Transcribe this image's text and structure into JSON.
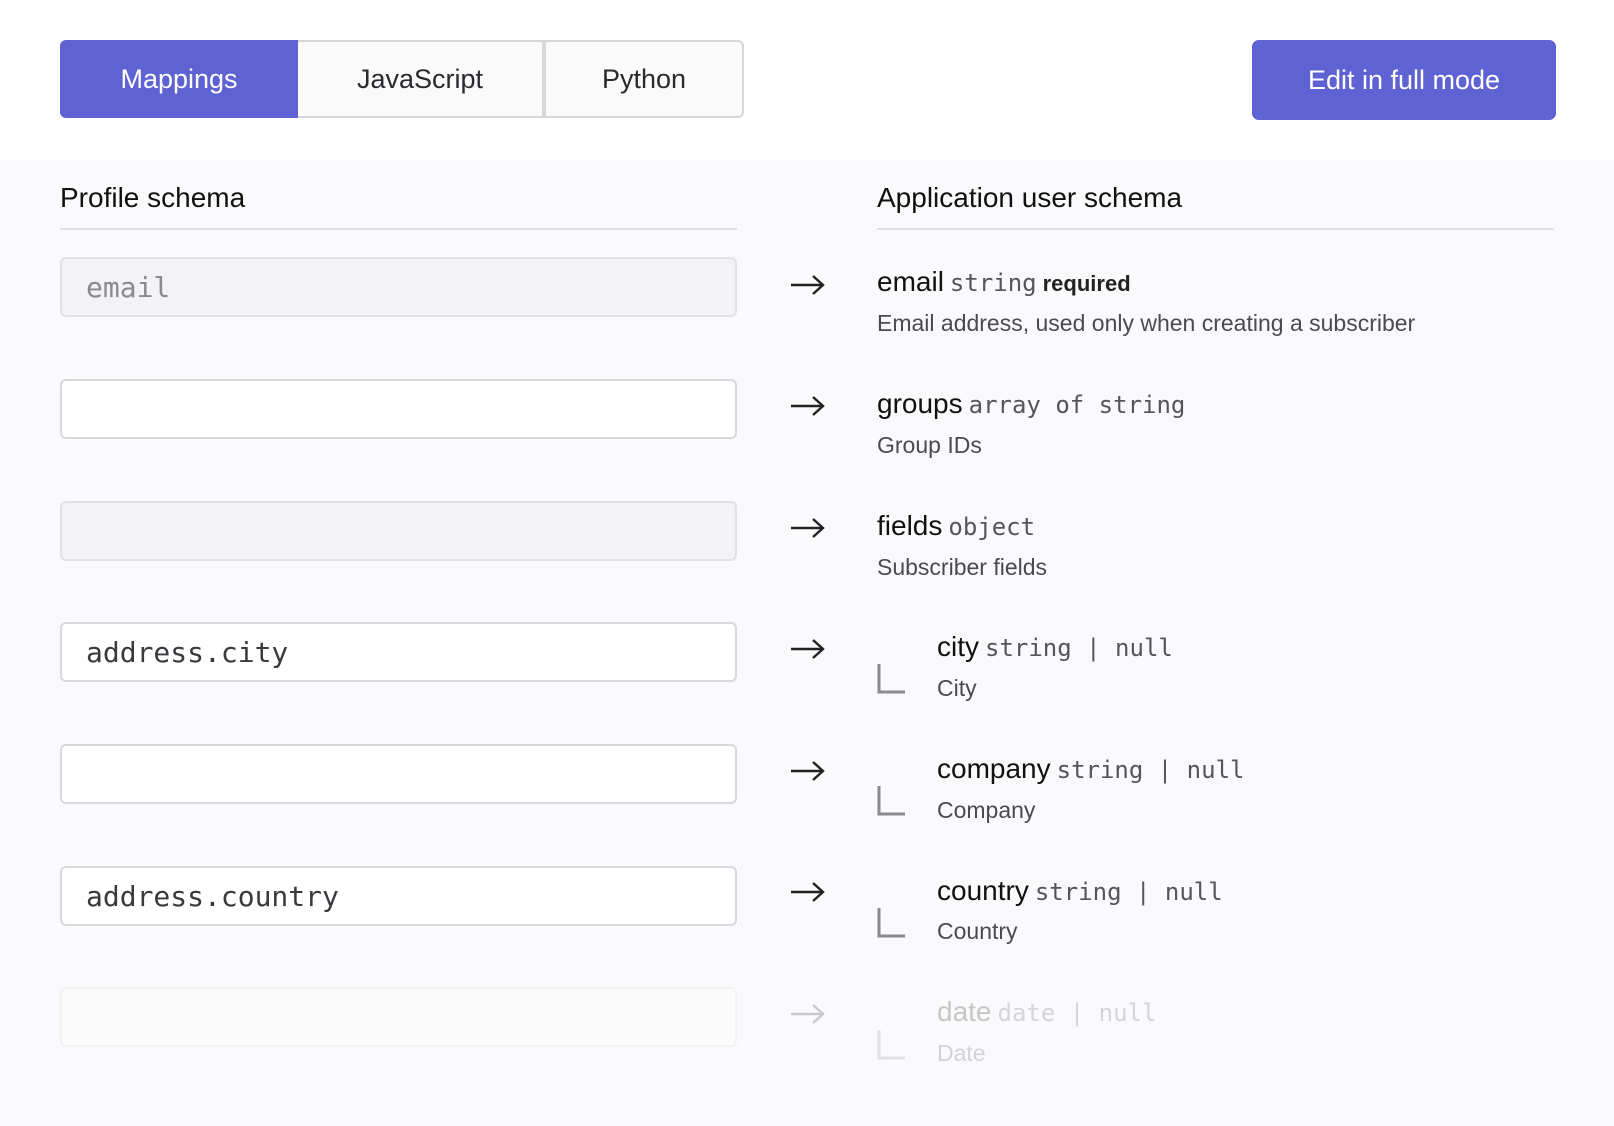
{
  "tabs": [
    {
      "label": "Mappings",
      "active": true
    },
    {
      "label": "JavaScript",
      "active": false
    },
    {
      "label": "Python",
      "active": false
    }
  ],
  "actions": {
    "edit_full_mode": "Edit in full mode"
  },
  "columns": {
    "left": "Profile schema",
    "right": "Application user schema"
  },
  "rows": [
    {
      "input_value": "",
      "input_placeholder": "email",
      "input_disabled": true,
      "name": "email",
      "type": "string",
      "required": "required",
      "description": "Email address, used only when creating a subscriber"
    },
    {
      "input_value": "",
      "input_placeholder": "",
      "input_disabled": false,
      "name": "groups",
      "type": "array of string",
      "description": "Group IDs"
    },
    {
      "input_value": "",
      "input_placeholder": "",
      "input_disabled": true,
      "name": "fields",
      "type": "object",
      "description": "Subscriber fields"
    },
    {
      "input_value": "address.city",
      "input_placeholder": "",
      "input_disabled": false,
      "name": "city",
      "type": "string | null",
      "description": "City",
      "nested": true
    },
    {
      "input_value": "",
      "input_placeholder": "",
      "input_disabled": false,
      "name": "company",
      "type": "string | null",
      "description": "Company",
      "nested": true
    },
    {
      "input_value": "address.country",
      "input_placeholder": "",
      "input_disabled": false,
      "name": "country",
      "type": "string | null",
      "description": "Country",
      "nested": true
    },
    {
      "input_value": "",
      "input_placeholder": "",
      "input_disabled": false,
      "name": "date",
      "type": "date | null",
      "description": "Date",
      "nested": true
    }
  ],
  "colors": {
    "accent": "#5f62d3",
    "panel_bg": "#fafafc"
  },
  "icons": {
    "mapping_arrow": "arrow-right-icon",
    "nesting": "nested-corner-icon"
  }
}
